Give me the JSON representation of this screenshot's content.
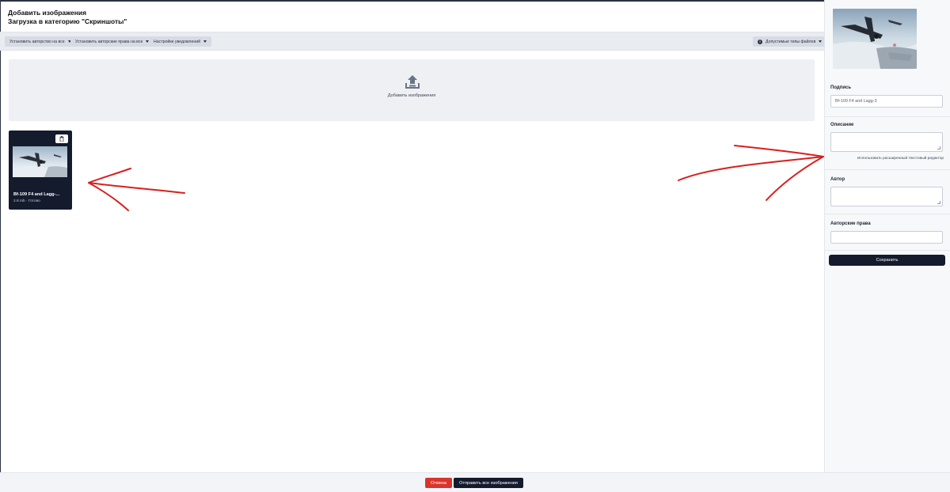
{
  "header": {
    "title": "Добавить изображения",
    "subtitle": "Загрузка в категорию \"Скриншоты\""
  },
  "toolbar": {
    "set_author_label": "Установить авторство на все",
    "set_copyright_label": "Установить авторские права на все",
    "notifications_label": "Настройки уведомлений",
    "file_types_label": "Допустимые типы файлов"
  },
  "dropzone": {
    "label": "Добавить изображения"
  },
  "files": [
    {
      "name": "Bf-109 F4 and Lagg-...",
      "meta": "2.8 mb · Готово"
    }
  ],
  "sidebar": {
    "caption_label": "Подпись",
    "caption_value": "Bf-109 F4 and Lagg-3",
    "description_label": "Описание",
    "description_value": "",
    "rich_editor_link": "Использовать расширенный текстовый редактор",
    "author_label": "Автор",
    "author_value": "",
    "copyright_label": "Авторские права",
    "copyright_value": "",
    "save_label": "Сохранить"
  },
  "footer": {
    "cancel_label": "Отмена",
    "submit_label": "Отправить все изображения"
  },
  "colors": {
    "primary_dark": "#141b2d",
    "danger": "#d9342b",
    "annotation_red": "#d8201c"
  }
}
